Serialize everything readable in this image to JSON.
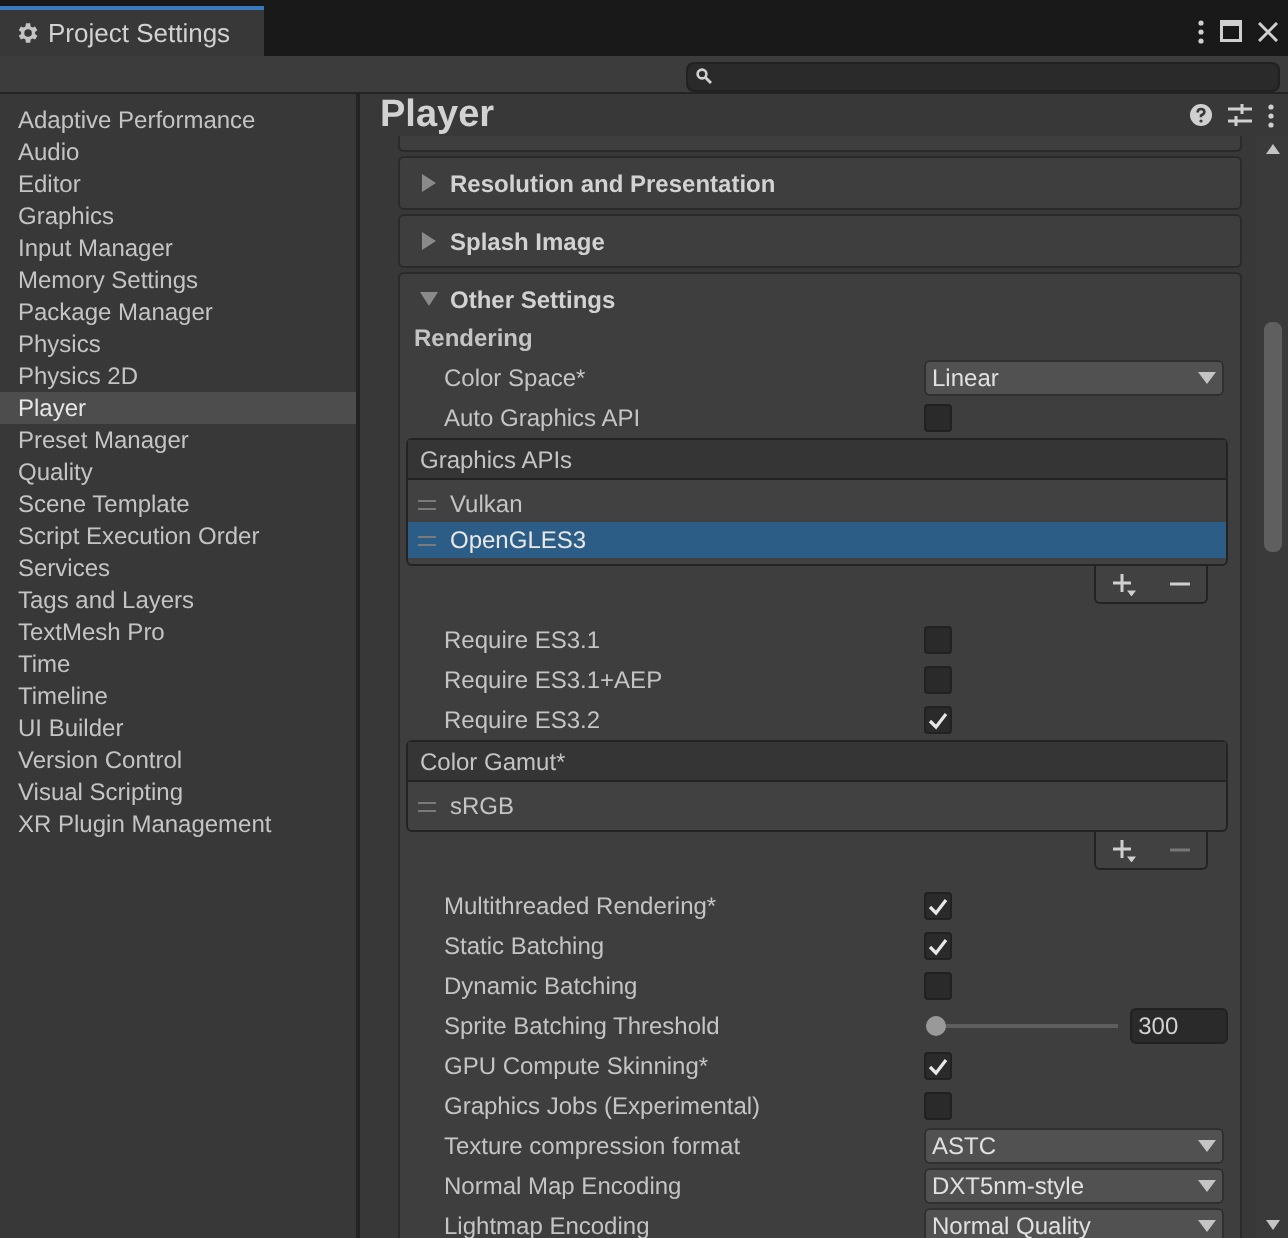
{
  "window": {
    "tab_title": "Project Settings"
  },
  "sidebar": {
    "items": [
      {
        "label": "Adaptive Performance",
        "selected": false
      },
      {
        "label": "Audio",
        "selected": false
      },
      {
        "label": "Editor",
        "selected": false
      },
      {
        "label": "Graphics",
        "selected": false
      },
      {
        "label": "Input Manager",
        "selected": false
      },
      {
        "label": "Memory Settings",
        "selected": false
      },
      {
        "label": "Package Manager",
        "selected": false
      },
      {
        "label": "Physics",
        "selected": false
      },
      {
        "label": "Physics 2D",
        "selected": false
      },
      {
        "label": "Player",
        "selected": true
      },
      {
        "label": "Preset Manager",
        "selected": false
      },
      {
        "label": "Quality",
        "selected": false
      },
      {
        "label": "Scene Template",
        "selected": false
      },
      {
        "label": "Script Execution Order",
        "selected": false
      },
      {
        "label": "Services",
        "selected": false
      },
      {
        "label": "Tags and Layers",
        "selected": false
      },
      {
        "label": "TextMesh Pro",
        "selected": false
      },
      {
        "label": "Time",
        "selected": false
      },
      {
        "label": "Timeline",
        "selected": false
      },
      {
        "label": "UI Builder",
        "selected": false
      },
      {
        "label": "Version Control",
        "selected": false
      },
      {
        "label": "Visual Scripting",
        "selected": false
      },
      {
        "label": "XR Plugin Management",
        "selected": false
      }
    ]
  },
  "panel": {
    "title": "Player",
    "sections": [
      {
        "title": "Resolution and Presentation",
        "expanded": false
      },
      {
        "title": "Splash Image",
        "expanded": false
      },
      {
        "title": "Other Settings",
        "expanded": true
      }
    ],
    "other_settings": {
      "heading": "Rendering",
      "rows": [
        {
          "kind": "dropdown",
          "label": "Color Space*",
          "value": "Linear"
        },
        {
          "kind": "checkbox",
          "label": "Auto Graphics API",
          "checked": false
        },
        {
          "kind": "list",
          "header": "Graphics APIs",
          "items": [
            {
              "label": "Vulkan",
              "selected": false
            },
            {
              "label": "OpenGLES3",
              "selected": true
            }
          ]
        },
        {
          "kind": "checkbox",
          "label": "Require ES3.1",
          "checked": false
        },
        {
          "kind": "checkbox",
          "label": "Require ES3.1+AEP",
          "checked": false
        },
        {
          "kind": "checkbox",
          "label": "Require ES3.2",
          "checked": true
        },
        {
          "kind": "list",
          "header": "Color Gamut*",
          "items": [
            {
              "label": "sRGB",
              "selected": false
            }
          ]
        },
        {
          "kind": "checkbox",
          "label": "Multithreaded Rendering*",
          "checked": true
        },
        {
          "kind": "checkbox",
          "label": "Static Batching",
          "checked": true
        },
        {
          "kind": "checkbox",
          "label": "Dynamic Batching",
          "checked": false
        },
        {
          "kind": "slider",
          "label": "Sprite Batching Threshold",
          "level": 0,
          "value": "300"
        },
        {
          "kind": "checkbox",
          "label": "GPU Compute Skinning*",
          "checked": true
        },
        {
          "kind": "checkbox",
          "label": "Graphics Jobs (Experimental)",
          "checked": false
        },
        {
          "kind": "dropdown",
          "label": "Texture compression format",
          "value": "ASTC"
        },
        {
          "kind": "dropdown",
          "label": "Normal Map Encoding",
          "value": "DXT5nm-style"
        },
        {
          "kind": "dropdown",
          "label": "Lightmap Encoding",
          "value": "Normal Quality"
        }
      ]
    }
  }
}
